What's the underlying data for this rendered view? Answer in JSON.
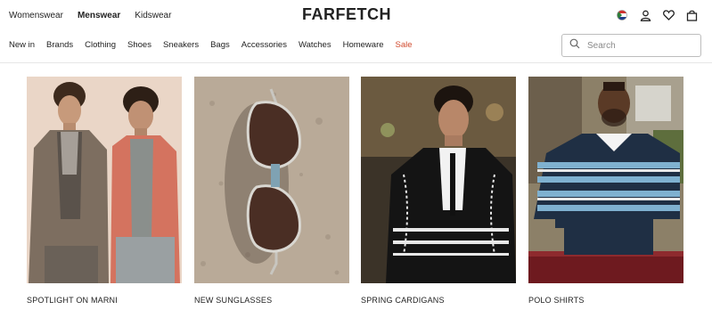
{
  "header": {
    "gender_tabs": [
      "Womenswear",
      "Menswear",
      "Kidswear"
    ],
    "active_gender": "Menswear",
    "logo": "FARFETCH",
    "icons": [
      "country-flag-icon",
      "account-icon",
      "wishlist-heart-icon",
      "shopping-bag-icon"
    ]
  },
  "nav": {
    "categories": [
      "New in",
      "Brands",
      "Clothing",
      "Shoes",
      "Sneakers",
      "Bags",
      "Accessories",
      "Watches",
      "Homeware",
      "Sale"
    ],
    "sale_color": "#d14b2f"
  },
  "search": {
    "placeholder": "Search"
  },
  "cards": [
    {
      "caption": "SPOTLIGHT ON MARNI"
    },
    {
      "caption": "NEW SUNGLASSES"
    },
    {
      "caption": "SPRING CARDIGANS"
    },
    {
      "caption": "POLO SHIRTS"
    }
  ]
}
